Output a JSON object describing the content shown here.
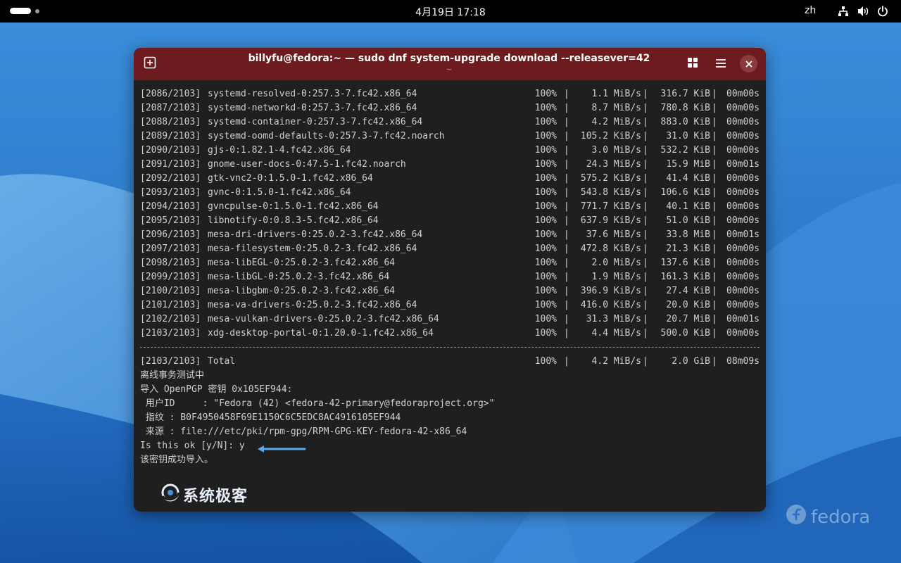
{
  "topbar": {
    "clock": "4月19日  17:18",
    "language": "zh",
    "icons": [
      "activities-indicator",
      "network-icon",
      "volume-icon",
      "power-icon"
    ]
  },
  "window": {
    "title": "billyfu@fedora:~ — sudo dnf system-upgrade download --releasever=42",
    "subtitle": "~",
    "accent_color": "#6d1b1f",
    "buttons": [
      "new-tab-icon",
      "tab-overview-icon",
      "menu-icon",
      "close-icon"
    ]
  },
  "terminal": {
    "packages": [
      {
        "id": "[2086/2103]",
        "name": "systemd-resolved-0:257.3-7.fc42.x86_64",
        "pct": "100%",
        "speed": "1.1 MiB/s",
        "size": "316.7 KiB",
        "time": "00m00s"
      },
      {
        "id": "[2087/2103]",
        "name": "systemd-networkd-0:257.3-7.fc42.x86_64",
        "pct": "100%",
        "speed": "8.7 MiB/s",
        "size": "780.8 KiB",
        "time": "00m00s"
      },
      {
        "id": "[2088/2103]",
        "name": "systemd-container-0:257.3-7.fc42.x86_64",
        "pct": "100%",
        "speed": "4.2 MiB/s",
        "size": "883.0 KiB",
        "time": "00m00s"
      },
      {
        "id": "[2089/2103]",
        "name": "systemd-oomd-defaults-0:257.3-7.fc42.noarch",
        "pct": "100%",
        "speed": "105.2 KiB/s",
        "size": "31.0 KiB",
        "time": "00m00s"
      },
      {
        "id": "[2090/2103]",
        "name": "gjs-0:1.82.1-4.fc42.x86_64",
        "pct": "100%",
        "speed": "3.0 MiB/s",
        "size": "532.2 KiB",
        "time": "00m00s"
      },
      {
        "id": "[2091/2103]",
        "name": "gnome-user-docs-0:47.5-1.fc42.noarch",
        "pct": "100%",
        "speed": "24.3 MiB/s",
        "size": "15.9 MiB",
        "time": "00m01s"
      },
      {
        "id": "[2092/2103]",
        "name": "gtk-vnc2-0:1.5.0-1.fc42.x86_64",
        "pct": "100%",
        "speed": "575.2 KiB/s",
        "size": "41.4 KiB",
        "time": "00m00s"
      },
      {
        "id": "[2093/2103]",
        "name": "gvnc-0:1.5.0-1.fc42.x86_64",
        "pct": "100%",
        "speed": "543.8 KiB/s",
        "size": "106.6 KiB",
        "time": "00m00s"
      },
      {
        "id": "[2094/2103]",
        "name": "gvncpulse-0:1.5.0-1.fc42.x86_64",
        "pct": "100%",
        "speed": "771.7 KiB/s",
        "size": "40.1 KiB",
        "time": "00m00s"
      },
      {
        "id": "[2095/2103]",
        "name": "libnotify-0:0.8.3-5.fc42.x86_64",
        "pct": "100%",
        "speed": "637.9 KiB/s",
        "size": "51.0 KiB",
        "time": "00m00s"
      },
      {
        "id": "[2096/2103]",
        "name": "mesa-dri-drivers-0:25.0.2-3.fc42.x86_64",
        "pct": "100%",
        "speed": "37.6 MiB/s",
        "size": "33.8 MiB",
        "time": "00m01s"
      },
      {
        "id": "[2097/2103]",
        "name": "mesa-filesystem-0:25.0.2-3.fc42.x86_64",
        "pct": "100%",
        "speed": "472.8 KiB/s",
        "size": "21.3 KiB",
        "time": "00m00s"
      },
      {
        "id": "[2098/2103]",
        "name": "mesa-libEGL-0:25.0.2-3.fc42.x86_64",
        "pct": "100%",
        "speed": "2.0 MiB/s",
        "size": "137.6 KiB",
        "time": "00m00s"
      },
      {
        "id": "[2099/2103]",
        "name": "mesa-libGL-0:25.0.2-3.fc42.x86_64",
        "pct": "100%",
        "speed": "1.9 MiB/s",
        "size": "161.3 KiB",
        "time": "00m00s"
      },
      {
        "id": "[2100/2103]",
        "name": "mesa-libgbm-0:25.0.2-3.fc42.x86_64",
        "pct": "100%",
        "speed": "396.9 KiB/s",
        "size": "27.4 KiB",
        "time": "00m00s"
      },
      {
        "id": "[2101/2103]",
        "name": "mesa-va-drivers-0:25.0.2-3.fc42.x86_64",
        "pct": "100%",
        "speed": "416.0 KiB/s",
        "size": "20.0 KiB",
        "time": "00m00s"
      },
      {
        "id": "[2102/2103]",
        "name": "mesa-vulkan-drivers-0:25.0.2-3.fc42.x86_64",
        "pct": "100%",
        "speed": "31.3 MiB/s",
        "size": "20.7 MiB",
        "time": "00m01s"
      },
      {
        "id": "[2103/2103]",
        "name": "xdg-desktop-portal-0:1.20.0-1.fc42.x86_64",
        "pct": "100%",
        "speed": "4.4 MiB/s",
        "size": "500.0 KiB",
        "time": "00m00s"
      }
    ],
    "total": {
      "id": "[2103/2103]",
      "name": "Total",
      "pct": "100%",
      "speed": "4.2 MiB/s",
      "size": "2.0 GiB",
      "time": "08m09s"
    },
    "messages": [
      "离线事务测试中",
      "导入 OpenPGP 密钥 0x105EF944:",
      " 用户ID     : \"Fedora (42) <fedora-42-primary@fedoraproject.org>\"",
      " 指纹 : B0F4950458F69E1150C6C5EDC8AC4916105EF944",
      " 来源 : file:///etc/pki/rpm-gpg/RPM-GPG-KEY-fedora-42-x86_64",
      "Is this ok [y/N]: y",
      "该密钥成功导入。"
    ]
  },
  "watermark": "系统极客",
  "desktop_logo": "fedora"
}
